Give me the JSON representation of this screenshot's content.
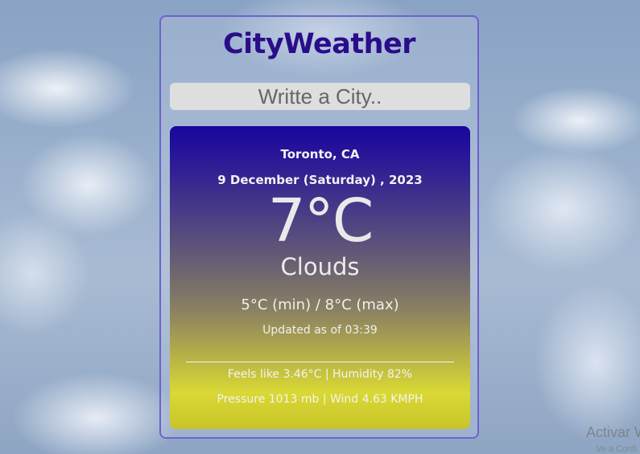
{
  "app": {
    "title": "CityWeather"
  },
  "search": {
    "placeholder": "Writte a City..",
    "value": ""
  },
  "weather": {
    "location": "Toronto, CA",
    "date": "9 December (Saturday) , 2023",
    "temperature": "7°C",
    "condition": "Clouds",
    "min_max": "5°C (min) / 8°C (max)",
    "updated": "Updated as of 03:39",
    "feels_humidity": "Feels like 3.46°C | Humidity 82%",
    "pressure_wind": "Pressure 1013 mb | Wind 4.63 KMPH"
  },
  "watermark": {
    "title": "Activar W",
    "subtitle": "Ve a Confi"
  },
  "colors": {
    "title": "#2a0d8a",
    "card_border": "#6f61d0",
    "panel_top": "#17069e",
    "panel_bottom": "#d9d834",
    "input_bg": "#dedede"
  }
}
